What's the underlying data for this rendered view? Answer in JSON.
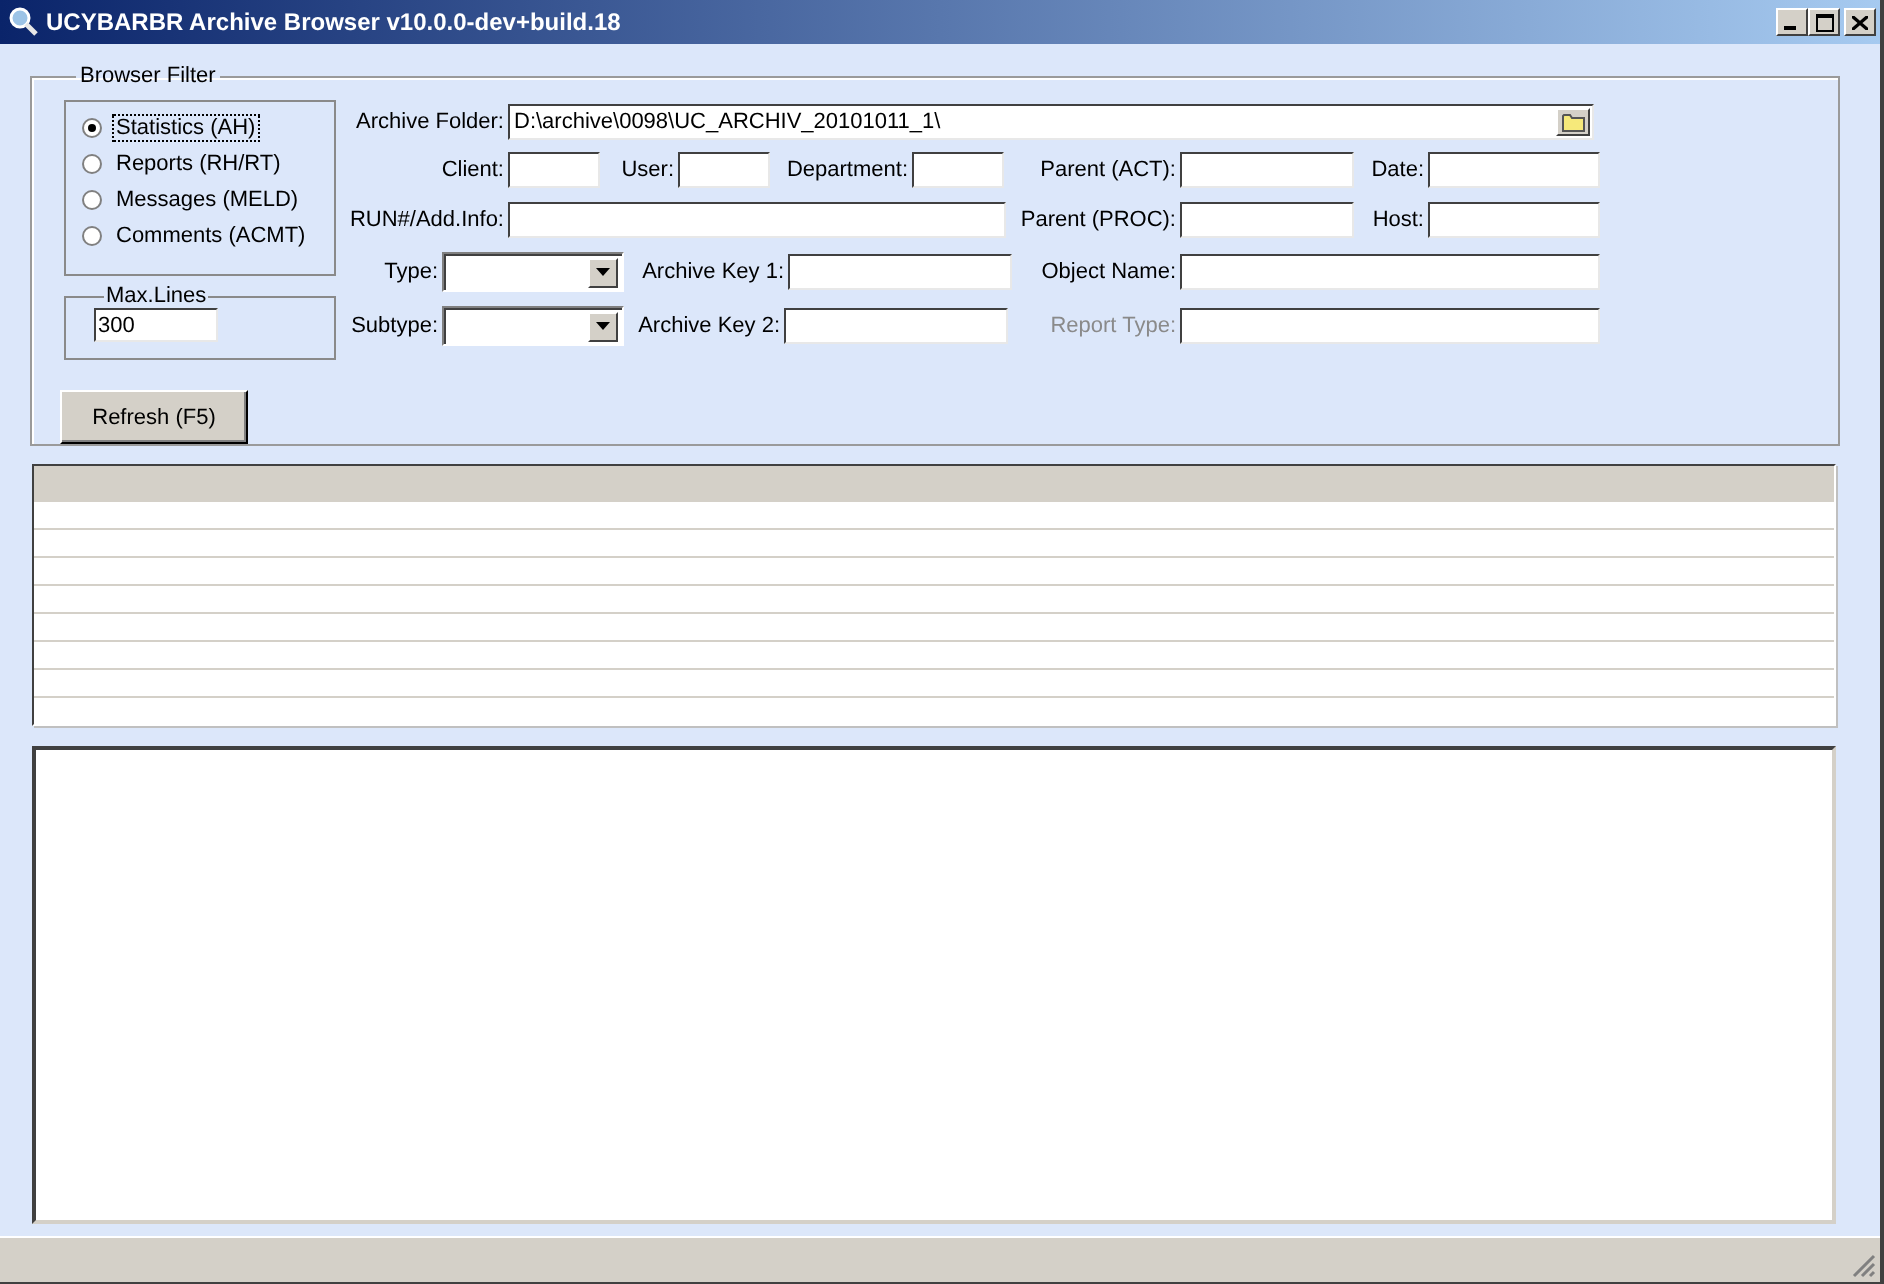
{
  "window": {
    "title": "UCYBARBR Archive Browser v10.0.0-dev+build.18"
  },
  "filter": {
    "title": "Browser Filter",
    "record_types": [
      {
        "label": "Statistics (AH)",
        "selected": true,
        "focused": true
      },
      {
        "label": "Reports (RH/RT)",
        "selected": false,
        "focused": false
      },
      {
        "label": "Messages (MELD)",
        "selected": false,
        "focused": false
      },
      {
        "label": "Comments (ACMT)",
        "selected": false,
        "focused": false
      }
    ],
    "max_lines": {
      "label": "Max.Lines",
      "value": "300"
    },
    "refresh_button": "Refresh (F5)",
    "fields": [
      {
        "kind": "text",
        "label": "Archive Folder:",
        "value": "D:\\archive\\0098\\UC_ARCHIV_20101011_1\\",
        "browse": true,
        "disabled": false
      },
      {
        "kind": "text",
        "label": "Client:",
        "browse": false,
        "disabled": false
      },
      {
        "kind": "text",
        "label": "User:",
        "browse": false,
        "disabled": false
      },
      {
        "kind": "text",
        "label": "Department:",
        "browse": false,
        "disabled": false
      },
      {
        "kind": "text",
        "label": "Parent (ACT):",
        "browse": false,
        "disabled": false
      },
      {
        "kind": "text",
        "label": "Date:",
        "browse": false,
        "disabled": false
      },
      {
        "kind": "text",
        "label": "RUN#/Add.Info:",
        "browse": false,
        "disabled": false
      },
      {
        "kind": "text",
        "label": "Parent (PROC):",
        "browse": false,
        "disabled": false
      },
      {
        "kind": "text",
        "label": "Host:",
        "browse": false,
        "disabled": false
      },
      {
        "kind": "combo",
        "label": "Type:",
        "browse": false,
        "disabled": false
      },
      {
        "kind": "text",
        "label": "Archive Key 1:",
        "browse": false,
        "disabled": false
      },
      {
        "kind": "text",
        "label": "Object Name:",
        "browse": false,
        "disabled": false
      },
      {
        "kind": "combo",
        "label": "Subtype:",
        "browse": false,
        "disabled": false
      },
      {
        "kind": "text",
        "label": "Archive Key 2:",
        "browse": false,
        "disabled": false
      },
      {
        "kind": "text",
        "label": "Report Type:",
        "browse": false,
        "disabled": true
      }
    ]
  }
}
